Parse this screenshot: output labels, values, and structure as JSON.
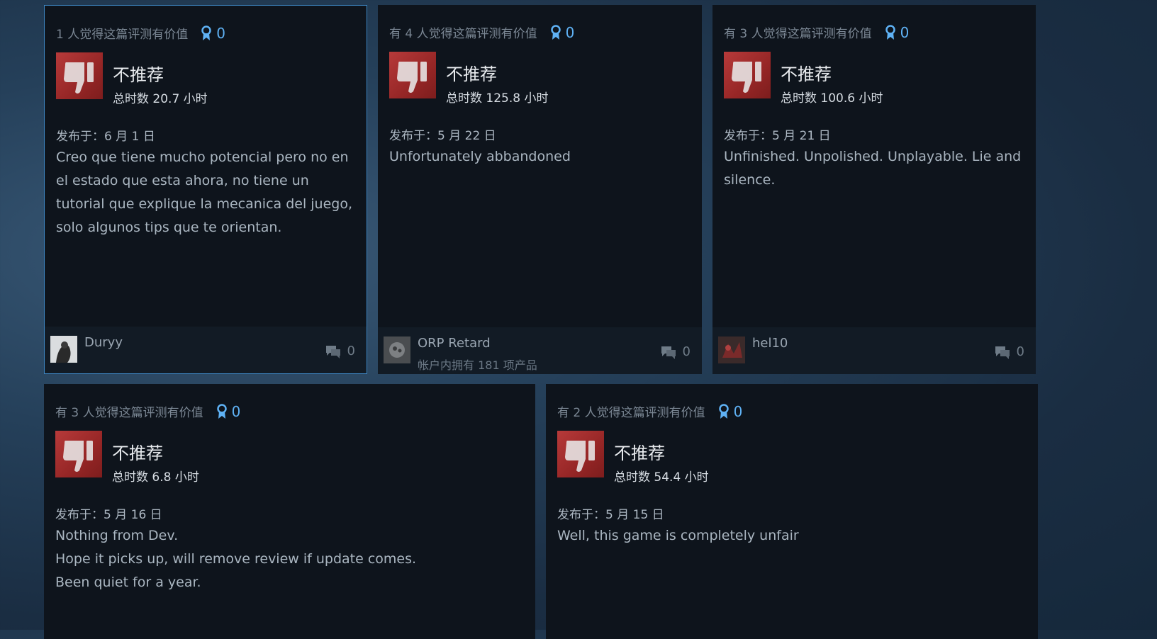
{
  "reviews": [
    {
      "helpful_text": "1 人觉得这篇评测有价值",
      "award_count": "0",
      "verdict": "不推荐",
      "hours": "总时数 20.7 小时",
      "posted": "发布于：6 月 1 日",
      "text": "Creo que tiene mucho potencial pero no en el estado que esta ahora, no tiene un tutorial que explique la mecanica del juego, solo algunos tips que te orientan.",
      "username": "Duryy",
      "products_owned": "",
      "comment_count": "0"
    },
    {
      "helpful_text": "有 4 人觉得这篇评测有价值",
      "award_count": "0",
      "verdict": "不推荐",
      "hours": "总时数 125.8 小时",
      "posted": "发布于：5 月 22 日",
      "text": "Unfortunately abbandoned",
      "username": "ORP Retard",
      "products_owned": "帐户内拥有 181 项产品",
      "comment_count": "0"
    },
    {
      "helpful_text": "有 3 人觉得这篇评测有价值",
      "award_count": "0",
      "verdict": "不推荐",
      "hours": "总时数 100.6 小时",
      "posted": "发布于：5 月 21 日",
      "text": "Unfinished. Unpolished. Unplayable. Lie and silence.",
      "username": "hel10",
      "products_owned": "",
      "comment_count": "0"
    },
    {
      "helpful_text": "有 3 人觉得这篇评测有价值",
      "award_count": "0",
      "verdict": "不推荐",
      "hours": "总时数 6.8 小时",
      "posted": "发布于：5 月 16 日",
      "text_lines": [
        "Nothing from Dev.",
        "Hope it picks up, will remove review if update comes.",
        "Been quiet for a year."
      ]
    },
    {
      "helpful_text": "有 2 人觉得这篇评测有价值",
      "award_count": "0",
      "verdict": "不推荐",
      "hours": "总时数 54.4 小时",
      "posted": "发布于：5 月 15 日",
      "text": "Well, this game is completely unfair"
    }
  ]
}
